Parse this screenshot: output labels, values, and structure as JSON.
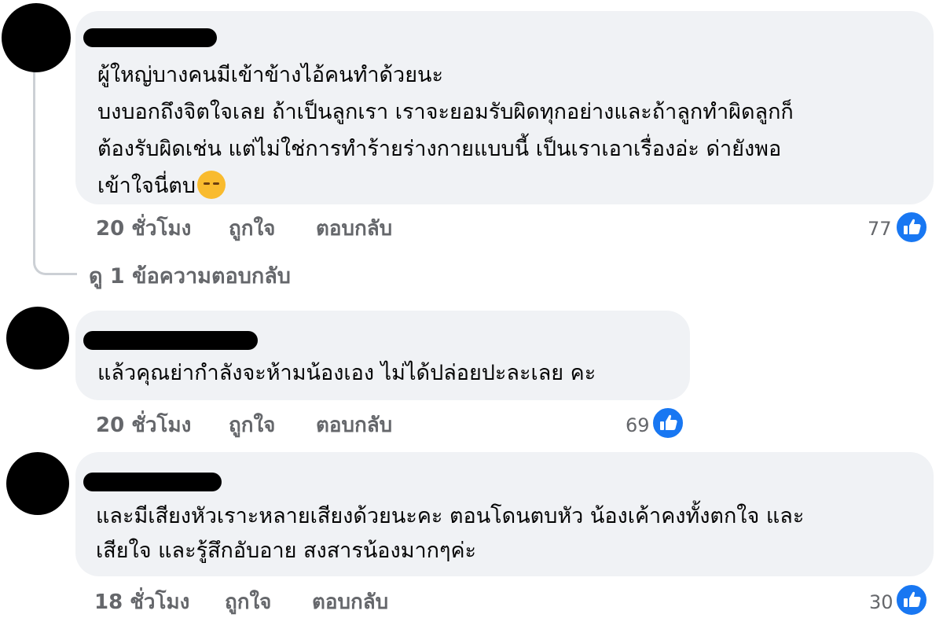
{
  "comments": [
    {
      "lines": [
        "ผู้ใหญ่บางคนมีเข้าข้างไอ้คนทำด้วยนะ",
        "บงบอกถึงจิตใจเลย ถ้าเป็นลูกเรา เราจะยอมรับผิดทุกอย่างและถ้าลูกทำผิดลูกก็",
        "ต้องรับผิดเช่น แต่ไม่ใช่การทำร้ายร่างกายแบบนี้ เป็นเราเอาเรื่องอ่ะ ด่ายังพอ",
        "เข้าใจนี่ตบ"
      ],
      "emoji": "disappointed-face-emoji",
      "time": "20 ชั่วโมง",
      "like_label": "ถูกใจ",
      "reply_label": "ตอบกลับ",
      "like_count": "77",
      "view_replies": "ดู 1 ข้อความตอบกลับ"
    },
    {
      "lines": [
        "แล้วคุณย่ากำลังจะห้ามน้องเอง ไม่ได้ปล่อยปะละเลย คะ"
      ],
      "time": "20 ชั่วโมง",
      "like_label": "ถูกใจ",
      "reply_label": "ตอบกลับ",
      "like_count": "69"
    },
    {
      "lines": [
        "และมีเสียงหัวเราะหลายเสียงด้วยนะคะ ตอนโดนตบหัว น้องเค้าคงทั้งตกใจ และ",
        "เสียใจ และรู้สึกอับอาย สงสารน้องมากๆค่ะ"
      ],
      "time": "18 ชั่วโมง",
      "like_label": "ถูกใจ",
      "reply_label": "ตอบกลับ",
      "like_count": "30"
    }
  ],
  "colors": {
    "bubble": "#f0f2f5",
    "meta_text": "#65676b",
    "like_blue": "#1877f2"
  },
  "icons": {
    "like_badge": "thumbs-up-icon"
  }
}
